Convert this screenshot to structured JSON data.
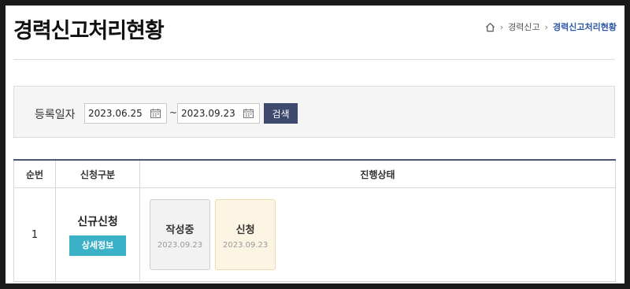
{
  "header": {
    "title": "경력신고처리현황",
    "breadcrumb": {
      "parent": "경력신고",
      "current": "경력신고처리현황"
    }
  },
  "search": {
    "label": "등록일자",
    "start_date": "2023.06.25",
    "end_date": "2023.09.23",
    "separator": "~",
    "button_label": "검색"
  },
  "table": {
    "headers": {
      "no": "순번",
      "type": "신청구분",
      "status": "진행상태"
    },
    "rows": [
      {
        "no": "1",
        "type": "신규신청",
        "detail_button": "상세정보",
        "steps": [
          {
            "name": "작성중",
            "date": "2023.09.23"
          },
          {
            "name": "신청",
            "date": "2023.09.23"
          }
        ]
      }
    ]
  },
  "colors": {
    "accent_navy": "#3d4a6d",
    "detail_teal": "#3bb1c8",
    "breadcrumb_current": "#2f5aa8"
  }
}
